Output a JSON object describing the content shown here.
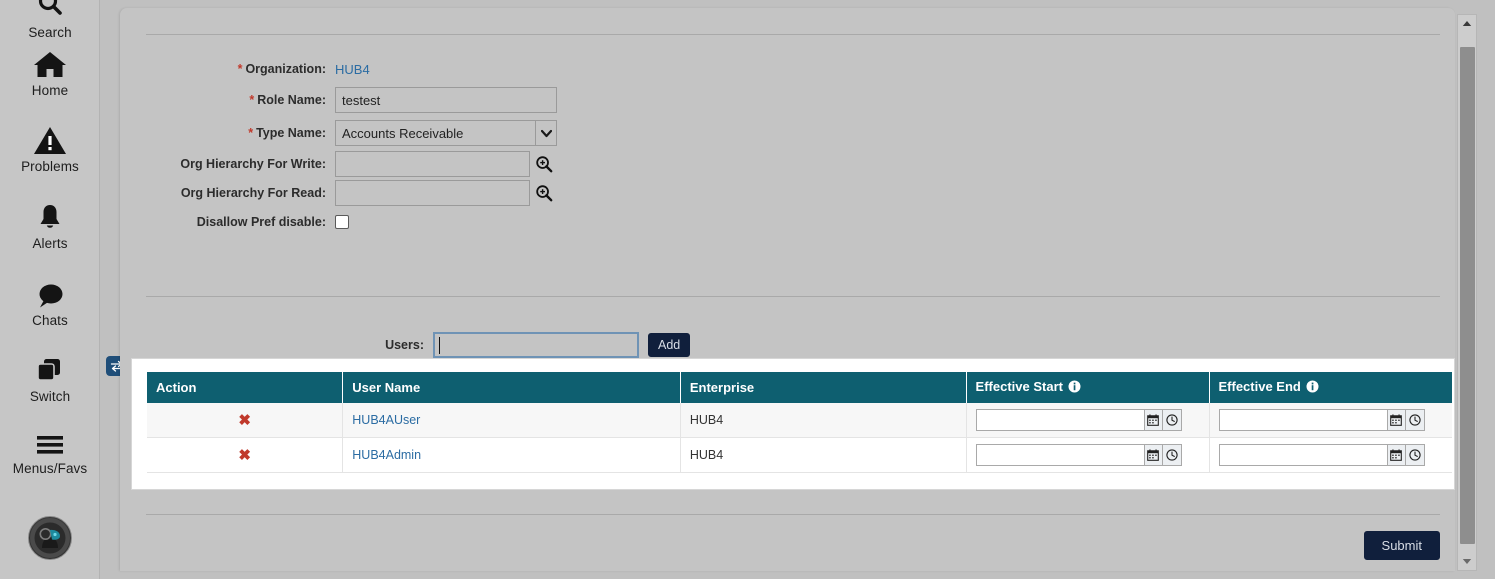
{
  "rail": {
    "items": [
      {
        "label": "Search",
        "icon": "search-icon"
      },
      {
        "label": "Home",
        "icon": "home-icon"
      },
      {
        "label": "Problems",
        "icon": "warning-triangle-icon"
      },
      {
        "label": "Alerts",
        "icon": "bell-icon"
      },
      {
        "label": "Chats",
        "icon": "chat-bubble-icon"
      },
      {
        "label": "Switch",
        "icon": "windows-stack-icon",
        "badge_icon": "swap-arrows-icon"
      },
      {
        "label": "Menus/Favs",
        "icon": "hamburger-menu-icon"
      }
    ],
    "avatar_icon": "user-avatar"
  },
  "form": {
    "organization": {
      "label": "Organization:",
      "required": true,
      "value": "HUB4"
    },
    "role_name": {
      "label": "Role Name:",
      "required": true,
      "value": "testest",
      "placeholder": ""
    },
    "type_name": {
      "label": "Type Name:",
      "required": true,
      "value": "Accounts Receivable",
      "dropdown_icon": "chevron-down-icon"
    },
    "org_hierarchy_write": {
      "label": "Org Hierarchy For Write:",
      "required": false,
      "value": "",
      "placeholder": "",
      "lookup_icon": "magnifier-plus-icon"
    },
    "org_hierarchy_read": {
      "label": "Org Hierarchy For Read:",
      "required": false,
      "value": "",
      "placeholder": "",
      "lookup_icon": "magnifier-plus-icon"
    },
    "disallow_pref_disable": {
      "label": "Disallow Pref disable:",
      "required": false,
      "checked": false
    }
  },
  "users_section": {
    "label": "Users:",
    "input_value": "",
    "input_placeholder": "",
    "add_label": "Add"
  },
  "table": {
    "columns": [
      {
        "header": "Action",
        "info": false
      },
      {
        "header": "User Name",
        "info": false
      },
      {
        "header": "Enterprise",
        "info": false
      },
      {
        "header": "Effective Start",
        "info": true,
        "info_icon": "info-circle-icon"
      },
      {
        "header": "Effective End",
        "info": true,
        "info_icon": "info-circle-icon"
      }
    ],
    "rows": [
      {
        "delete_icon": "delete-x-icon",
        "user_name": "HUB4AUser",
        "enterprise": "HUB4",
        "effective_start": "",
        "effective_end": "",
        "calendar_icon": "calendar-icon",
        "clock_icon": "clock-icon"
      },
      {
        "delete_icon": "delete-x-icon",
        "user_name": "HUB4Admin",
        "enterprise": "HUB4",
        "effective_start": "",
        "effective_end": "",
        "calendar_icon": "calendar-icon",
        "clock_icon": "clock-icon"
      }
    ]
  },
  "footer": {
    "submit_label": "Submit"
  },
  "scrollbar": {
    "up_icon": "caret-up-icon",
    "down_icon": "caret-down-icon"
  },
  "colors": {
    "table_header": "#0e5f70",
    "primary_button": "#101f3c",
    "link": "#2b6ca3",
    "required_asterisk": "#c0392b",
    "delete_x": "#c0392b",
    "page_background": "#c4c4c4",
    "rail_background": "#c6c6c6",
    "badge": "#1f4e79"
  }
}
